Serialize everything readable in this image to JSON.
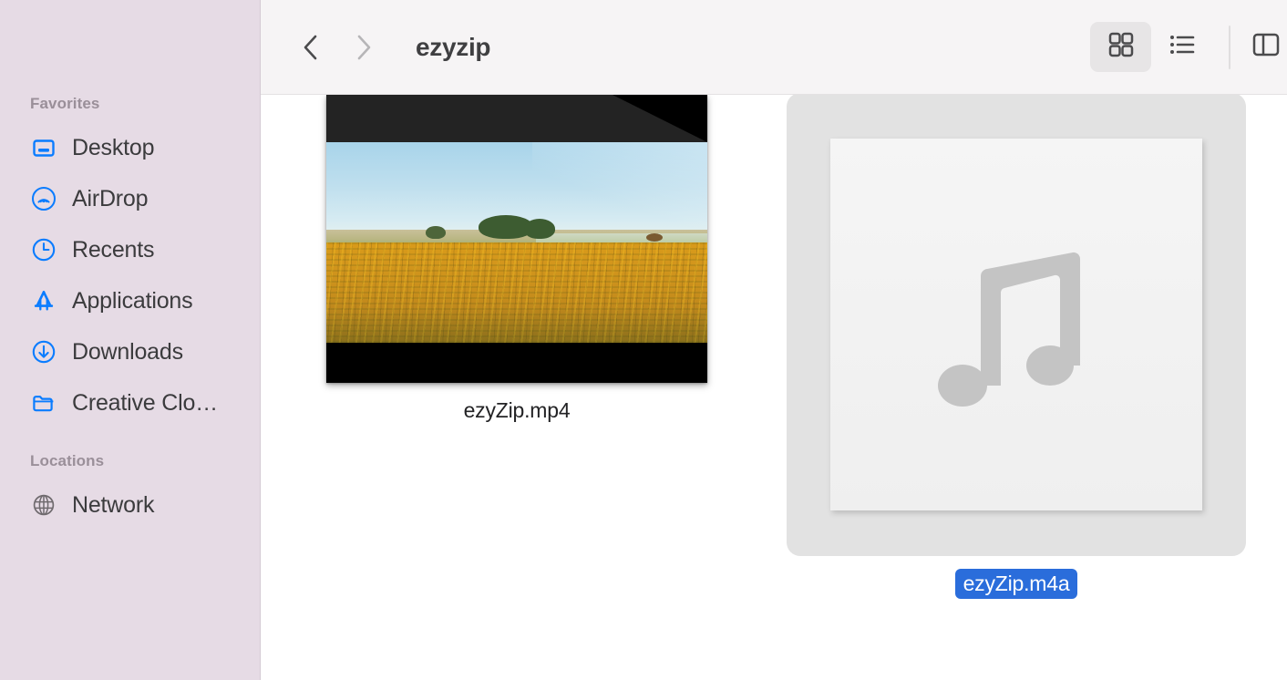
{
  "window": {
    "title": "ezyzip",
    "accent_blue": "#0a7cff",
    "selection_blue": "#2a6ddb",
    "sidebar_bg": "#e6dbe5",
    "toolbar_bg": "#f6f4f5",
    "content_bg": "#ffffff",
    "selection_tile_bg": "#e2e2e2"
  },
  "toolbar": {
    "back_label": "Back",
    "forward_label": "Forward",
    "back_icon": "chevron-left-icon",
    "forward_icon": "chevron-right-icon",
    "title": "ezyzip",
    "views": [
      {
        "id": "icon",
        "label": "Icon View",
        "icon": "grid-view-icon",
        "active": true
      },
      {
        "id": "list",
        "label": "List View",
        "icon": "list-view-icon",
        "active": false
      },
      {
        "id": "column",
        "label": "Column View",
        "icon": "column-view-icon",
        "active": false
      }
    ]
  },
  "sidebar": {
    "groups": [
      {
        "title": "Favorites",
        "items": [
          {
            "label": "Desktop",
            "icon": "desktop-icon"
          },
          {
            "label": "AirDrop",
            "icon": "airdrop-icon"
          },
          {
            "label": "Recents",
            "icon": "clock-icon"
          },
          {
            "label": "Applications",
            "icon": "applications-icon"
          },
          {
            "label": "Downloads",
            "icon": "download-icon"
          },
          {
            "label": "Creative Clo…",
            "icon": "folder-icon"
          }
        ]
      },
      {
        "title": "Locations",
        "items": [
          {
            "label": "Network",
            "icon": "globe-icon"
          }
        ]
      }
    ]
  },
  "files": [
    {
      "name": "ezyZip.mp4",
      "kind": "video",
      "selected": false,
      "thumbnail": "sunflower-field-aerial-letterboxed"
    },
    {
      "name": "ezyZip.m4a",
      "kind": "audio",
      "selected": true,
      "thumbnail": "music-note-document-icon"
    }
  ]
}
